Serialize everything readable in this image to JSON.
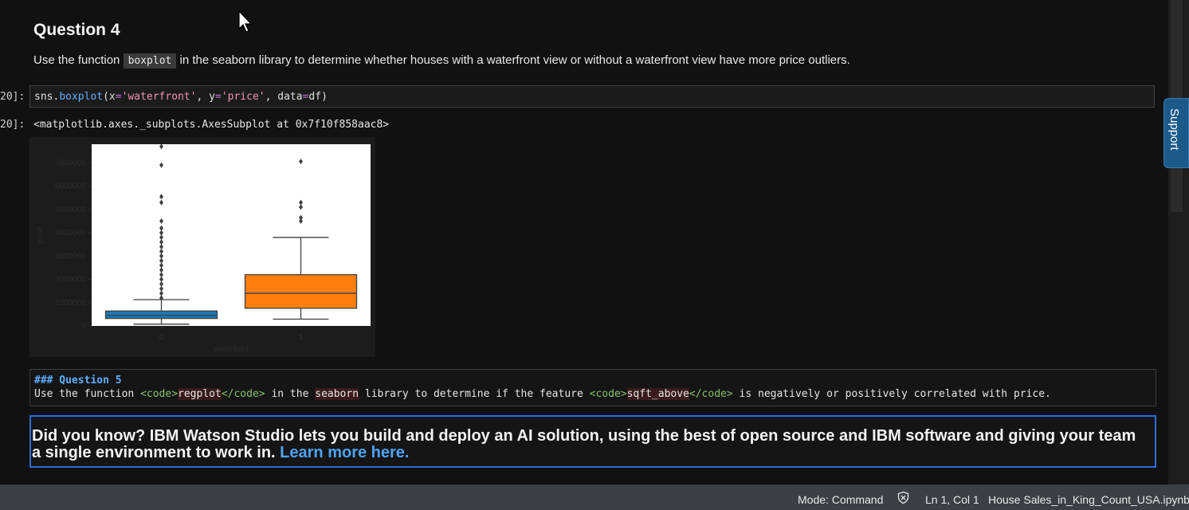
{
  "question4": {
    "heading": "Question 4",
    "text_before": "Use the function",
    "code": "boxplot",
    "text_after": "in the seaborn library to determine whether houses with a waterfront view or without a waterfront view have more price outliers."
  },
  "code_cell": {
    "prompt": "20]:",
    "code": {
      "obj": "sns.",
      "fn": "boxplot",
      "open": "(x",
      "eq1": "=",
      "s1": "'waterfront'",
      "mid1": ", y",
      "eq2": "=",
      "s2": "'price'",
      "mid2": ", data",
      "eq3": "=",
      "close": "df)"
    }
  },
  "output_cell": {
    "prompt": "20]:",
    "text": "<matplotlib.axes._subplots.AxesSubplot at 0x7f10f858aac8>"
  },
  "chart_data": {
    "type": "boxplot",
    "xlabel": "waterfront",
    "ylabel": "price",
    "categories": [
      "0",
      "1"
    ],
    "ylim": [
      0,
      7800000
    ],
    "yticks": [
      0,
      1000000,
      2000000,
      3000000,
      4000000,
      5000000,
      6000000,
      7000000
    ],
    "ytick_labels": [
      "0",
      "1000000",
      "2000000",
      "3000000",
      "4000000",
      "5000000",
      "6000000",
      "7000000"
    ],
    "series": [
      {
        "category": "0",
        "color": "#1f77b4",
        "whisker_low": 75000,
        "q1": 320000,
        "median": 450000,
        "q3": 640000,
        "whisker_high": 1130000,
        "outliers": [
          1200000,
          1400000,
          1600000,
          1800000,
          2000000,
          2200000,
          2400000,
          2600000,
          2800000,
          3000000,
          3200000,
          3400000,
          3600000,
          3800000,
          4000000,
          4200000,
          4500000,
          5300000,
          5550000,
          6900000,
          7700000
        ]
      },
      {
        "category": "1",
        "color": "#ff7f0e",
        "whisker_low": 290000,
        "q1": 760000,
        "median": 1400000,
        "q3": 2200000,
        "whisker_high": 3800000,
        "outliers": [
          4500000,
          4650000,
          5100000,
          5300000,
          7060000
        ]
      }
    ]
  },
  "markdown_cell": {
    "line1": "### Question 5",
    "l2_a": "Use the function ",
    "l2_tag1_open": "<code>",
    "l2_word1": "regplot",
    "l2_tag1_close": "</code>",
    "l2_b": "  in the ",
    "l2_word2": "seaborn",
    "l2_c": " library  to  determine if the feature ",
    "l2_tag2_open": "<code>",
    "l2_word3": "sqft_above",
    "l2_tag2_close": "</code>",
    "l2_d": " is negatively or positively correlated with price."
  },
  "did_you_know": {
    "bold": "Did you know?",
    "text": " IBM Watson Studio lets you build and deploy an AI solution, using the best of open source and IBM software and giving your team a single environment to work in. ",
    "link": "Learn more here."
  },
  "support": {
    "label": "Support"
  },
  "status_bar": {
    "mode": "Mode: Command",
    "icon": "shield-x-icon",
    "position": "Ln 1, Col 1",
    "filename": "House Sales_in_King_Count_USA.ipynb"
  },
  "colors": {
    "accent_blue": "#2f6bd8",
    "link": "#4fa3f5",
    "box0": "#1f77b4",
    "box1": "#ff7f0e"
  }
}
